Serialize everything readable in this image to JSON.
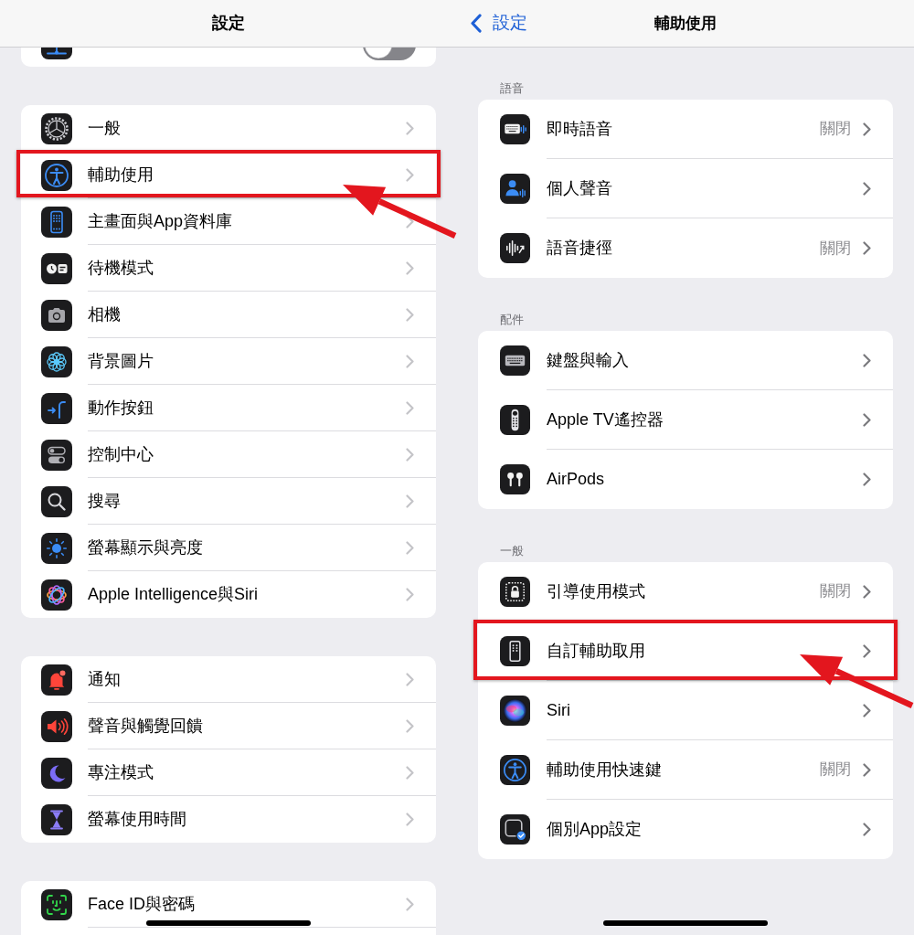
{
  "left_screen": {
    "nav_bar": {
      "title": "設定"
    },
    "cut_off_row": {
      "toggle": {
        "on": false
      }
    },
    "groups": [
      {
        "rows": [
          {
            "label": "一般",
            "highlighted": false
          },
          {
            "label": "輔助使用",
            "highlighted": true
          },
          {
            "label": "主畫面與App資料庫",
            "highlighted": false
          },
          {
            "label": "待機模式",
            "highlighted": false
          },
          {
            "label": "相機",
            "highlighted": false
          },
          {
            "label": "背景圖片",
            "highlighted": false
          },
          {
            "label": "動作按鈕",
            "highlighted": false
          },
          {
            "label": "控制中心",
            "highlighted": false
          },
          {
            "label": "搜尋",
            "highlighted": false
          },
          {
            "label": "螢幕顯示與亮度",
            "highlighted": false
          },
          {
            "label": "Apple Intelligence與Siri",
            "highlighted": false
          }
        ]
      },
      {
        "rows": [
          {
            "label": "通知",
            "highlighted": false
          },
          {
            "label": "聲音與觸覺回饋",
            "highlighted": false
          },
          {
            "label": "專注模式",
            "highlighted": false
          },
          {
            "label": "螢幕使用時間",
            "highlighted": false
          }
        ]
      },
      {
        "rows": [
          {
            "label": "Face ID與密碼",
            "highlighted": false
          }
        ]
      }
    ]
  },
  "right_screen": {
    "nav_bar": {
      "back": "設定",
      "title": "輔助使用"
    },
    "sections": [
      {
        "header": "語音",
        "rows": [
          {
            "label": "即時語音",
            "value": "關閉",
            "highlighted": false
          },
          {
            "label": "個人聲音",
            "highlighted": false
          },
          {
            "label": "語音捷徑",
            "value": "關閉",
            "highlighted": false
          }
        ]
      },
      {
        "header": "配件",
        "rows": [
          {
            "label": "鍵盤與輸入",
            "highlighted": false
          },
          {
            "label": "Apple TV遙控器",
            "highlighted": false
          },
          {
            "label": "AirPods",
            "highlighted": false
          }
        ]
      },
      {
        "header": "一般",
        "rows": [
          {
            "label": "引導使用模式",
            "value": "關閉",
            "highlighted": false
          },
          {
            "label": "自訂輔助取用",
            "highlighted": true
          },
          {
            "label": "Siri",
            "highlighted": false
          },
          {
            "label": "輔助使用快速鍵",
            "value": "關閉",
            "highlighted": false
          },
          {
            "label": "個別App設定",
            "highlighted": false
          }
        ]
      }
    ]
  }
}
